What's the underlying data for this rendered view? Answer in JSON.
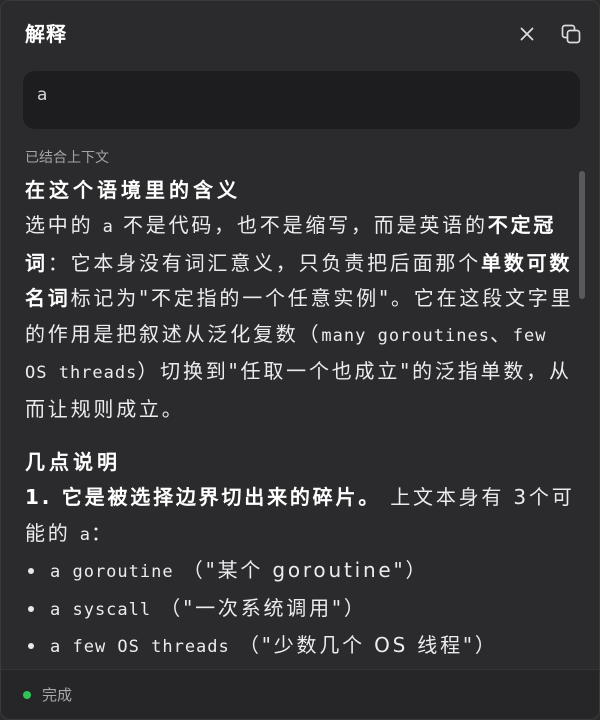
{
  "header": {
    "title": "解释"
  },
  "query": {
    "value": "a"
  },
  "context_note": "已结合上下文",
  "section1": {
    "heading": "在这个语境里的含义",
    "p_a": "选中的 ",
    "p_code": "a",
    "p_b": " 不是代码，也不是缩写，而是英语的",
    "p_bold1": "不定冠词",
    "p_c": "：它本身没有词汇意义，只负责把后面那个",
    "p_bold2": "单数可数名词",
    "p_d": "标记为\"不定指的一个任意实例\"。它在这段文字里的作用是把叙述从泛化复数（",
    "p_code2": "many goroutines",
    "p_e": "、",
    "p_code3": "few OS threads",
    "p_f": "）切换到\"任取一个也成立\"的泛指单数，从而让规则成立。"
  },
  "section2": {
    "heading": "几点说明",
    "item1_bold": "1. 它是被选择边界切出来的碎片。",
    "item1_a": " 上文本身有 3个可能的 ",
    "item1_code": "a",
    "item1_b": "：",
    "bullets": [
      {
        "code": "a goroutine",
        "text": "（\"某个 goroutine\"）"
      },
      {
        "code": "a syscall",
        "text": "（\"一次系统调用\"）"
      },
      {
        "code": "a few OS threads",
        "text": "（\"少数几个 OS 线程\"）"
      }
    ]
  },
  "footer": {
    "status": "完成",
    "status_color": "#2fc35a"
  },
  "icons": {
    "close": "close-icon",
    "copy": "copy-icon"
  }
}
